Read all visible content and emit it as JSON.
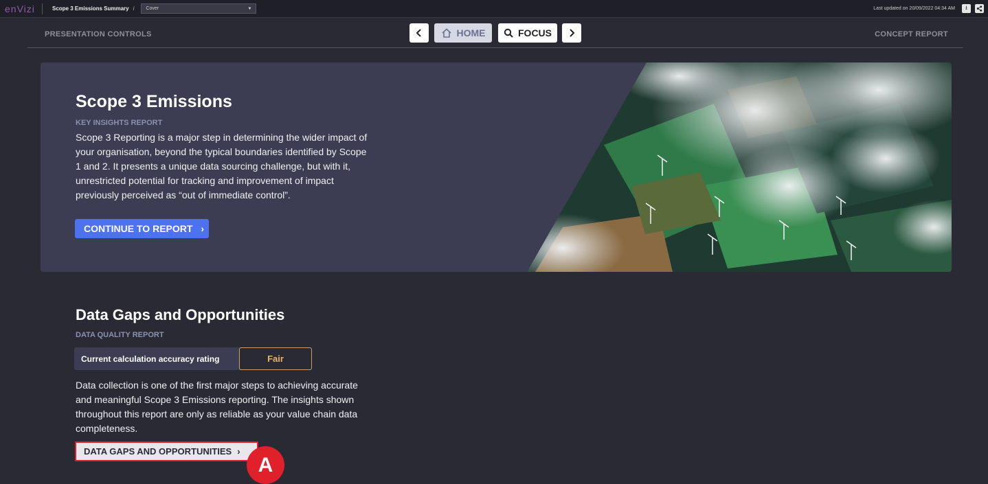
{
  "topbar": {
    "logo": "enVizi",
    "title": "Scope 3 Emissions Summary",
    "edit_icon": "i",
    "page_select": "Cover",
    "last_updated": "Last updated on 20/09/2022 04:34 AM",
    "icons": [
      "download-icon",
      "share-icon"
    ]
  },
  "controls": {
    "left_label": "PRESENTATION CONTROLS",
    "right_label": "CONCEPT REPORT",
    "home_label": "HOME",
    "focus_label": "FOCUS"
  },
  "hero": {
    "title": "Scope 3 Emissions",
    "subtitle": "KEY INSIGHTS REPORT",
    "description": "Scope 3 Reporting is a major step in determining the wider impact of your organisation, beyond the typical boundaries identified by Scope 1 and 2. It presents a unique data sourcing challenge, but with it, unrestricted potential for tracking and improvement of impact previously perceived as “out of immediate control”.",
    "button_label": "CONTINUE TO REPORT"
  },
  "data_gaps": {
    "title": "Data Gaps and Opportunities",
    "subtitle": "DATA QUALITY REPORT",
    "rating_label": "Current calculation accuracy rating",
    "rating_value": "Fair",
    "description": "Data collection is one of the first major steps to achieving accurate and meaningful Scope 3 Emissions reporting. The insights shown throughout this report are only as reliable as your value chain data completeness.",
    "button_label": "DATA GAPS AND OPPORTUNITIES"
  },
  "annotation": {
    "marker": "A"
  },
  "colors": {
    "background": "#2a2a35",
    "panel": "#3c3d52",
    "primary": "#4d72ee",
    "rating": "#e8b36c",
    "highlight": "#e0202a",
    "logo": "#8b5fa8"
  }
}
